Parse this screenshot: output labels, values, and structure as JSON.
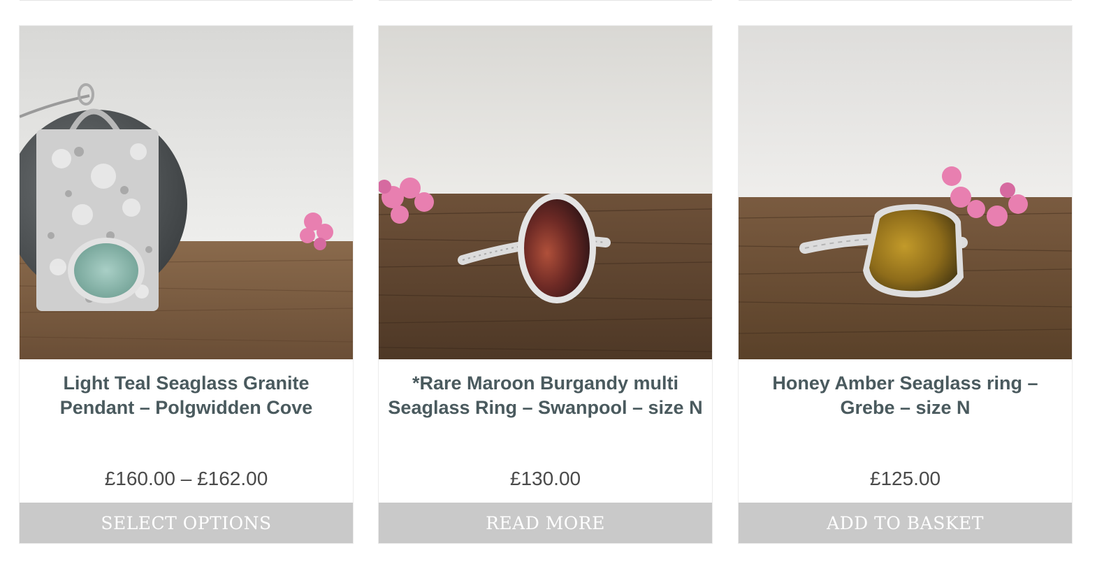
{
  "colors": {
    "title": "#4a5a5e",
    "price": "#4a4a4a",
    "button_bg": "#c9c9c9",
    "button_text": "#ffffff"
  },
  "products": [
    {
      "title": "Light Teal Seaglass Granite Pendant – Polgwidden Cove",
      "price": "£160.00 – £162.00",
      "button": "SELECT OPTIONS",
      "image": "pendant-photo"
    },
    {
      "title": "*Rare Maroon Burgandy multi Seaglass Ring – Swanpool – size N",
      "price": "£130.00",
      "button": "READ MORE",
      "image": "maroon-ring-photo"
    },
    {
      "title": "Honey Amber Seaglass ring – Grebe – size N",
      "price": "£125.00",
      "button": "ADD TO BASKET",
      "image": "amber-ring-photo"
    }
  ]
}
